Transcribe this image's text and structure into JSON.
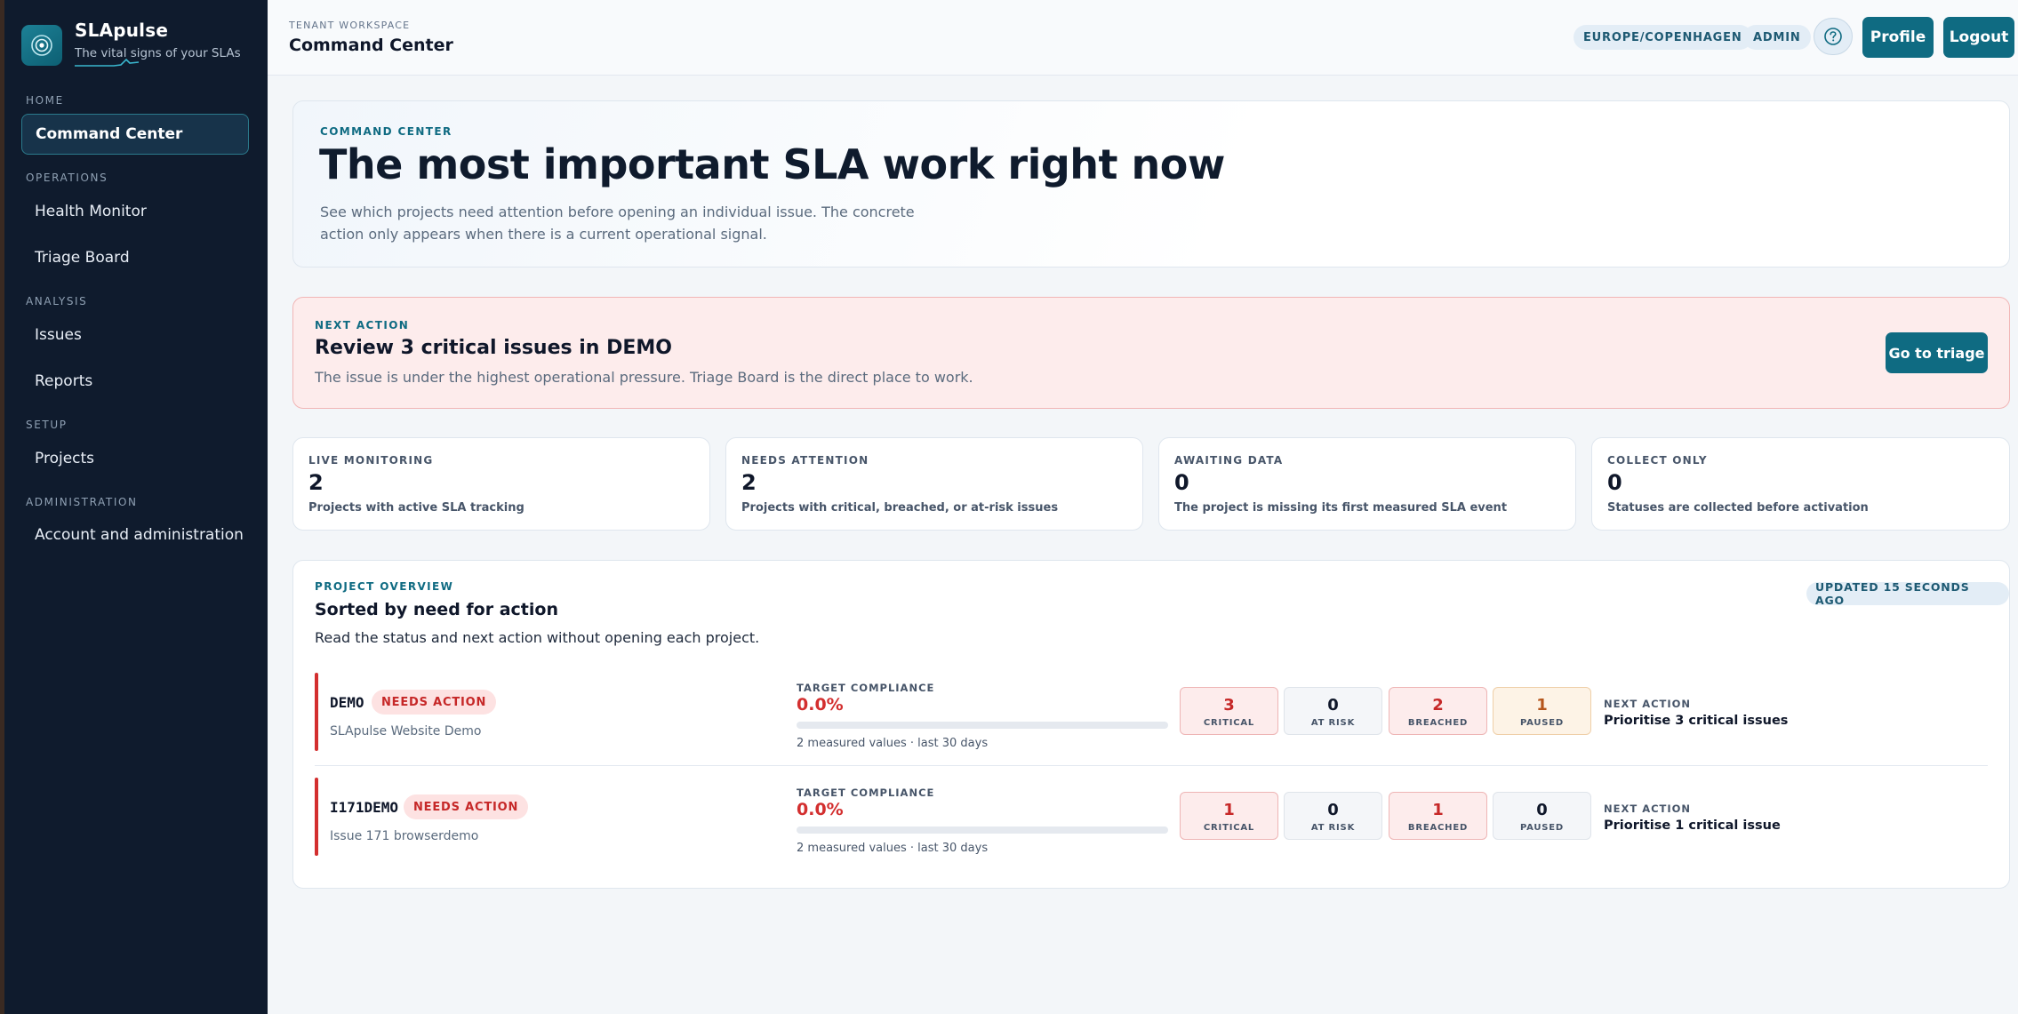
{
  "brand": {
    "name": "SLApulse",
    "tagline": "The vital signs of your SLAs"
  },
  "colors": {
    "sidebar_bg": "#0f1b2d",
    "accent": "#0f6b82",
    "danger": "#d32f2f",
    "alert_bg": "#fdecec"
  },
  "sidebar": {
    "sections": [
      "HOME",
      "OPERATIONS",
      "ANALYSIS",
      "SETUP",
      "ADMINISTRATION"
    ],
    "items": [
      {
        "label": "Command Center",
        "active": true
      },
      {
        "label": "Health Monitor"
      },
      {
        "label": "Triage Board"
      },
      {
        "label": "Issues"
      },
      {
        "label": "Reports"
      },
      {
        "label": "Projects"
      },
      {
        "label": "Account and administration"
      }
    ]
  },
  "topbar": {
    "context_label": "TENANT WORKSPACE",
    "title": "Command Center",
    "timezone": "EUROPE/COPENHAGEN",
    "role": "ADMIN",
    "help_icon": "question-circle-icon",
    "profile_label": "Profile",
    "logout_label": "Logout"
  },
  "hero": {
    "eyebrow": "COMMAND CENTER",
    "title": "The most important SLA work right now",
    "description": "See which projects need attention before opening an individual issue. The concrete action only appears when there is a current operational signal."
  },
  "next_action": {
    "eyebrow": "NEXT ACTION",
    "title": "Review 3 critical issues in DEMO",
    "description": "The issue is under the highest operational pressure. Triage Board is the direct place to work.",
    "button_label": "Go to triage"
  },
  "stats": [
    {
      "label": "LIVE MONITORING",
      "value": "2",
      "description": "Projects with active SLA tracking"
    },
    {
      "label": "NEEDS ATTENTION",
      "value": "2",
      "description": "Projects with critical, breached, or at-risk issues"
    },
    {
      "label": "AWAITING DATA",
      "value": "0",
      "description": "The project is missing its first measured SLA event"
    },
    {
      "label": "COLLECT ONLY",
      "value": "0",
      "description": "Statuses are collected before activation"
    }
  ],
  "overview": {
    "eyebrow": "PROJECT OVERVIEW",
    "title": "Sorted by need for action",
    "description": "Read the status and next action without opening each project.",
    "updated": "UPDATED 15 SECONDS AGO",
    "compliance_label": "TARGET COMPLIANCE",
    "next_action_label": "NEXT ACTION",
    "count_labels": {
      "critical": "CRITICAL",
      "at_risk": "AT RISK",
      "breached": "BREACHED",
      "paused": "PAUSED"
    },
    "projects": [
      {
        "key": "DEMO",
        "badge": "NEEDS ACTION",
        "name": "SLApulse Website Demo",
        "compliance": "0.0%",
        "compliance_fraction": 0.0,
        "meta": "2 measured values · last 30 days",
        "critical": "3",
        "at_risk": "0",
        "breached": "2",
        "paused": "1",
        "next_action": "Prioritise 3 critical issues"
      },
      {
        "key": "I171DEMO",
        "badge": "NEEDS ACTION",
        "name": "Issue 171 browserdemo",
        "compliance": "0.0%",
        "compliance_fraction": 0.0,
        "meta": "2 measured values · last 30 days",
        "critical": "1",
        "at_risk": "0",
        "breached": "1",
        "paused": "0",
        "next_action": "Prioritise 1 critical issue"
      }
    ]
  }
}
